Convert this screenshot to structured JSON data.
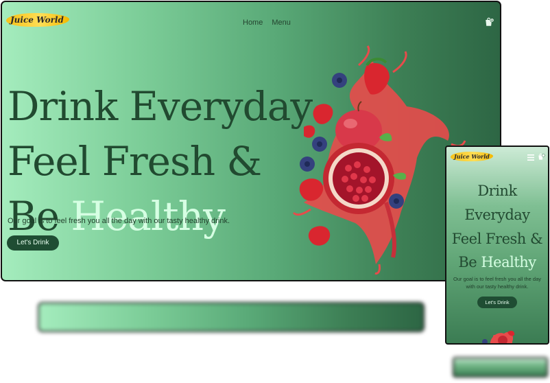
{
  "brand": {
    "logo_text": "Juice World"
  },
  "nav": {
    "links": [
      "Home",
      "Menu"
    ]
  },
  "hero": {
    "line1": "Drink Everyday",
    "line2": "Feel Fresh &",
    "line3_prefix": "Be ",
    "line3_accent": "Healthy",
    "tagline": "Our goal is to feel fresh you all the day with our tasty healthy drink.",
    "cta_label": "Let's Drink"
  },
  "mobile": {
    "hero_lines": [
      "Drink",
      "Everyday",
      "Feel Fresh &"
    ],
    "hero_last_prefix": "Be ",
    "hero_last_accent": "Healthy",
    "tagline": "Our goal is to feel fresh you all the day with our tasty healthy drink.",
    "cta_label": "Let's Drink"
  },
  "icons": {
    "cart": "shopping-bag-icon",
    "menu": "hamburger-menu-icon"
  },
  "colors": {
    "accent_text": "#d6ffe3",
    "button": "#1f4d33",
    "logo_yellow": "#f6c21a",
    "gradient_start": "#a4ecbd",
    "gradient_end": "#2d6644"
  }
}
